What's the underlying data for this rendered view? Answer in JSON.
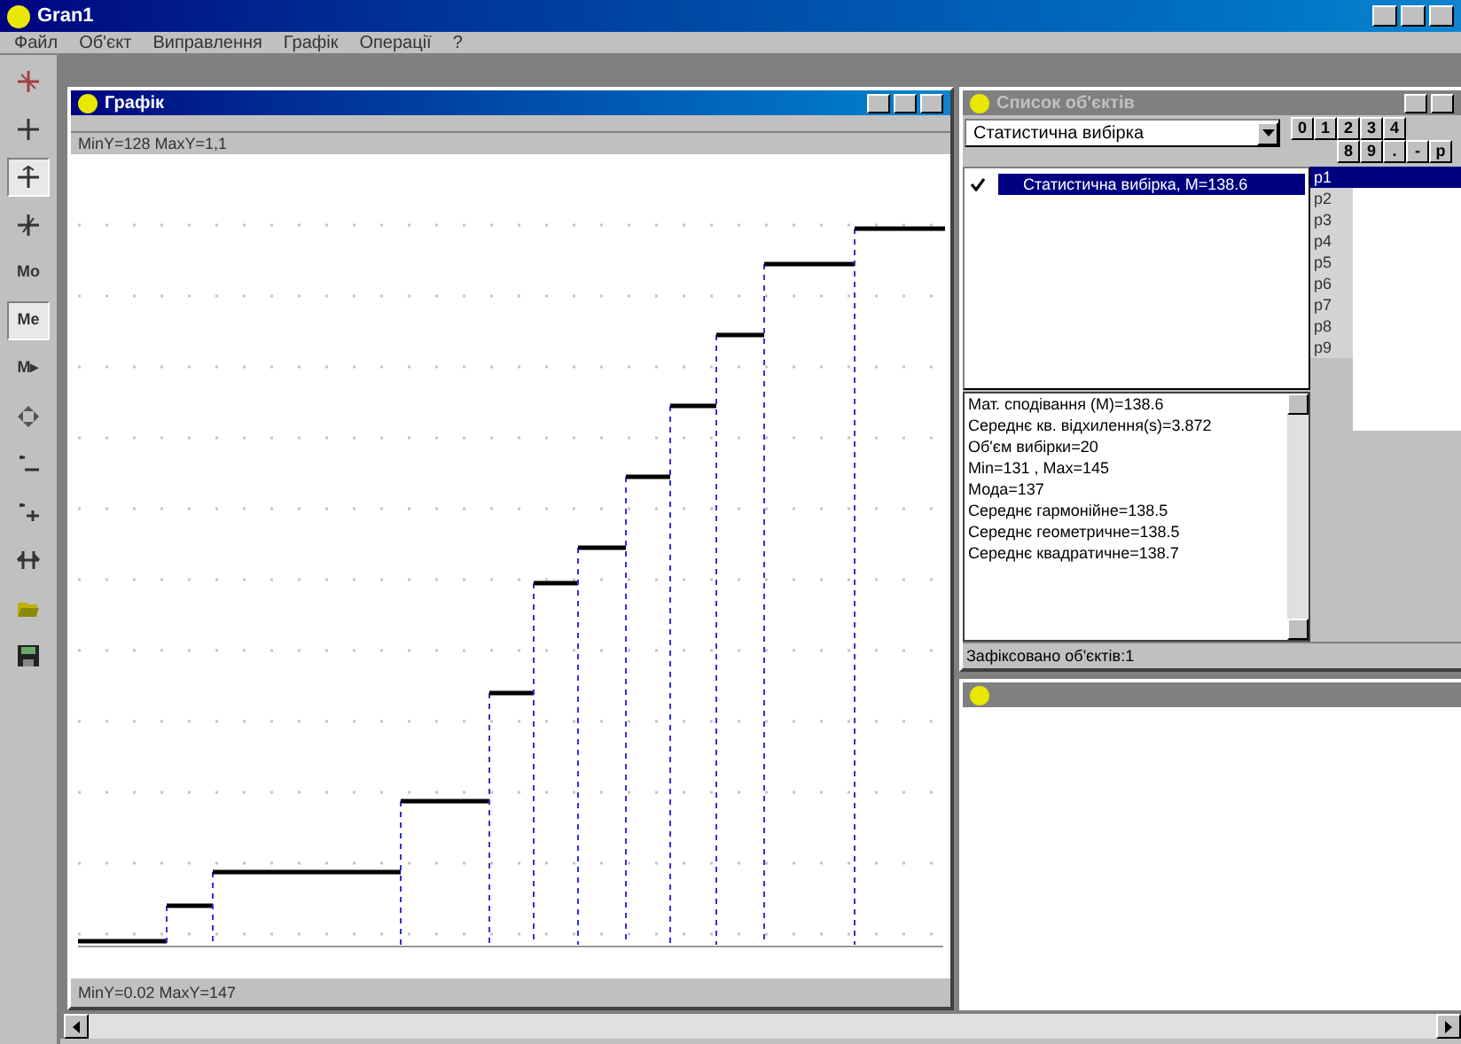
{
  "window": {
    "title": "Gran1"
  },
  "menu": [
    "Файл",
    "Об'єкт",
    "Виправлення",
    "Графік",
    "Операції",
    "?"
  ],
  "toolbar": [
    {
      "kind": "icon",
      "selected": false
    },
    {
      "kind": "icon",
      "selected": false
    },
    {
      "kind": "icon",
      "selected": true
    },
    {
      "kind": "icon",
      "selected": false
    },
    {
      "kind": "text",
      "label": "Mo",
      "selected": false
    },
    {
      "kind": "text",
      "label": "Me",
      "selected": true
    },
    {
      "kind": "text",
      "label": "M▸",
      "selected": false
    },
    {
      "kind": "icon",
      "selected": false
    },
    {
      "kind": "icon",
      "selected": false
    },
    {
      "kind": "icon",
      "selected": false
    },
    {
      "kind": "icon",
      "selected": false
    },
    {
      "kind": "icon",
      "selected": false
    },
    {
      "kind": "icon",
      "selected": false
    }
  ],
  "graph_window": {
    "title": "Графік",
    "top_label": "MinY=128 MaxY=1,1",
    "bottom_label": "MinY=0.02 MaxY=147"
  },
  "objects_window": {
    "title": "Список об'єктів",
    "combo_value": "Статистична вибірка",
    "keys_row_1": [
      "0",
      "1",
      "2",
      "3",
      "4"
    ],
    "keys_row_2": [
      "8",
      "9",
      ".",
      "-",
      "p"
    ],
    "objects": [
      {
        "label": "Статистична вибірка, M=138.6",
        "checked": true,
        "selected": true
      }
    ],
    "params": [
      {
        "label": "p1",
        "selected": true
      },
      {
        "label": "p2",
        "selected": false
      },
      {
        "label": "p3",
        "selected": false
      },
      {
        "label": "p4",
        "selected": false
      },
      {
        "label": "p5",
        "selected": false
      },
      {
        "label": "p6",
        "selected": false
      },
      {
        "label": "p7",
        "selected": false
      },
      {
        "label": "p8",
        "selected": false
      },
      {
        "label": "p9",
        "selected": false
      }
    ],
    "stats": [
      "Мат. сподівання (M)=138.6",
      "Середнє кв. відхилення(s)=3.872",
      "Об'єм вибірки=20",
      "Min=131 , Max=145",
      "Мода=137",
      "Середнє гармонійне=138.5",
      "Середнє геометричне=138.5",
      "Середнє квадратичне=138.7"
    ],
    "status": "Зафіксовано об'єктів:1"
  }
}
